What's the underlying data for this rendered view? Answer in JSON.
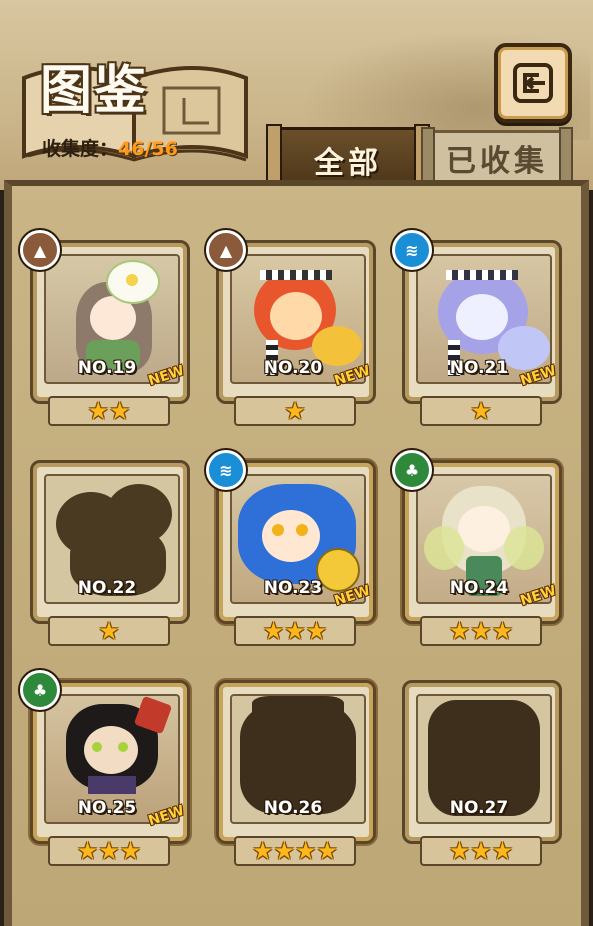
{
  "header": {
    "title": "图鉴",
    "progress_label": "收集度：",
    "progress_value": "46/56"
  },
  "tabs": [
    {
      "label": "全部",
      "active": true
    },
    {
      "label": "已收集",
      "active": false
    }
  ],
  "cards": [
    {
      "no": "NO.19",
      "stars": "★★",
      "new": "NEW",
      "element": "earth-icon",
      "collected": true
    },
    {
      "no": "NO.20",
      "stars": "★",
      "new": "NEW",
      "element": "earth-icon",
      "collected": true
    },
    {
      "no": "NO.21",
      "stars": "★",
      "new": "NEW",
      "element": "water-icon",
      "collected": true
    },
    {
      "no": "NO.22",
      "stars": "★",
      "new": "",
      "element": "",
      "collected": false
    },
    {
      "no": "NO.23",
      "stars": "★★★",
      "new": "NEW",
      "element": "water-icon",
      "collected": true
    },
    {
      "no": "NO.24",
      "stars": "★★★",
      "new": "NEW",
      "element": "wood-icon",
      "collected": true
    },
    {
      "no": "NO.25",
      "stars": "★★★",
      "new": "NEW",
      "element": "wood-icon",
      "collected": true
    },
    {
      "no": "NO.26",
      "stars": "★★★★",
      "new": "",
      "element": "",
      "collected": false
    },
    {
      "no": "NO.27",
      "stars": "★★★",
      "new": "",
      "element": "",
      "collected": false
    }
  ],
  "colors": {
    "earth": "#8a5a3a",
    "water": "#1b8fd6",
    "wood": "#2e8a3a",
    "star": "#ffb81c",
    "progress": "#ff9a1a"
  }
}
